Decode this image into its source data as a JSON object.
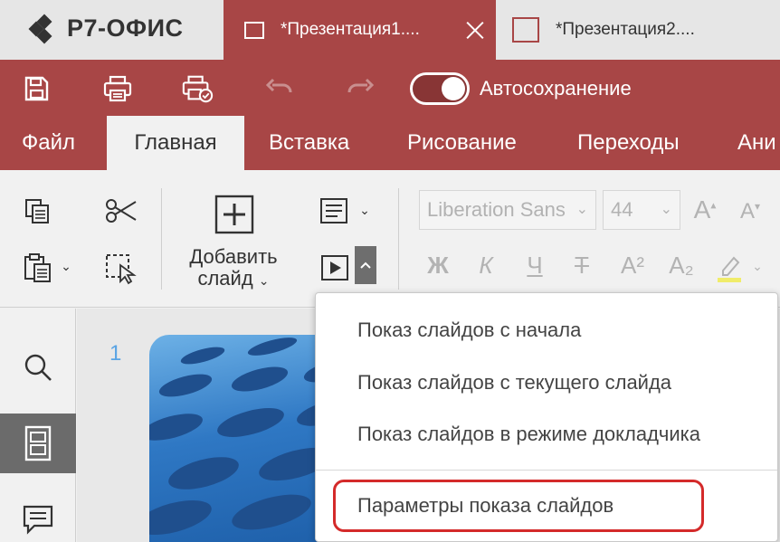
{
  "brand": {
    "name": "Р7-ОФИС"
  },
  "tabs": [
    {
      "title": "*Презентация1....",
      "active": true
    },
    {
      "title": "*Презентация2....",
      "active": false
    }
  ],
  "quick_access": {
    "icons": [
      "save-icon",
      "print-icon",
      "quick-print-icon",
      "undo-icon",
      "redo-icon"
    ],
    "autosave": {
      "label": "Автосохранение",
      "enabled": true
    }
  },
  "menu": {
    "tabs": [
      "Файл",
      "Главная",
      "Вставка",
      "Рисование",
      "Переходы",
      "Ани"
    ],
    "active": "Главная"
  },
  "toolbar": {
    "add_slide_label_1": "Добавить",
    "add_slide_label_2": "слайд",
    "font_name": "Liberation Sans",
    "font_size": "44",
    "bold": "Ж",
    "italic": "К",
    "underline": "Ч",
    "strike": "Т",
    "superscript": "A²",
    "subscript": "A₂",
    "grow": "A",
    "shrink": "A"
  },
  "slide_panel": {
    "number": "1"
  },
  "dropdown": {
    "items": [
      "Показ слайдов с начала",
      "Показ слайдов с текущего слайда",
      "Показ слайдов в режиме докладчика",
      "Параметры показа слайдов"
    ],
    "highlighted_index": 3
  },
  "colors": {
    "accent": "#a84646",
    "highlight": "#d42a2a",
    "slide_number": "#5aa4e4"
  }
}
